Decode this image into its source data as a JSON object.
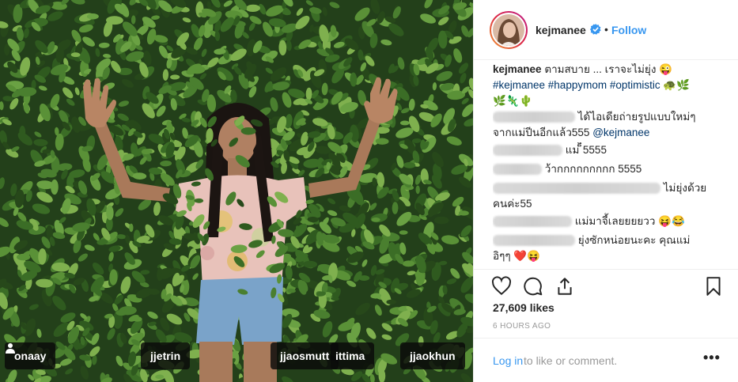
{
  "post": {
    "username": "kejmanee",
    "dot": "•",
    "follow_label": "Follow"
  },
  "photo_tags": [
    "onaay",
    "jjetrin",
    "jjaosmutt",
    "ittima",
    "jjaokhun"
  ],
  "caption": {
    "username": "kejmanee",
    "text": "ตามสบาย ... เราจะไม่ยุ่ง 😜",
    "hashtags": "#kejmanee #happymom #optimistic",
    "emoji_line1": "🐢🌿",
    "emoji_line2": "🌿🦎🌵"
  },
  "comments": [
    {
      "text": "ได้ไอเดียถ่ายรูปแบบใหม่ๆ",
      "text2": "จากแม่ปีนอีกแล้ว555",
      "mention": "@kejmanee"
    },
    {
      "text": "แม่ ็็็็็็็็็็็็็็็็็็็็็็็็็็็็็็็็็็็็็็็็็็็็็็็็็็็็็็็็็็็็็็็็็็็็็็็็็็็็็็็็็็็็็็็็็็็็็็็็็็็็็็็็็็็็็็็็็็็็็็็็็็็็็็็็็็็็็็็็็็็็็็็็็็็็็็็็็็็็็็็็็็็็็็็็็็็็็็็็็็็็็็็็็็็็็็็็็็็็็็็็็็็็็็็็็็็็็็็็็็็็็็็็็็็็็็็็็็็็็็็็็็็็็็็็็็็5555"
    },
    {
      "text": "ว้ากกกกกกกกก 5555"
    },
    {
      "text": "ไม่ยุ่งด้วย",
      "text2": "คนค่ะ55"
    },
    {
      "text": "แม่มาจี้เลยยยยวว 😝😂"
    },
    {
      "text": "ยุ่งซักหน่อยนะคะ คุณแม่",
      "text2": "อิๆๆ ❤️😝"
    }
  ],
  "stats": {
    "likes": "27,609 likes",
    "time": "6 HOURS AGO"
  },
  "footer": {
    "login_label": "Log in",
    "login_rest": "to like or comment.",
    "more_label": "•••"
  },
  "colors": {
    "link_blue": "#3897f0",
    "hashtag_navy": "#003569",
    "text_dark": "#262626",
    "muted_gray": "#999999",
    "divider": "#efefef"
  },
  "icons": [
    "verified-badge-icon",
    "heart-icon",
    "comment-icon",
    "share-icon",
    "bookmark-icon",
    "person-tag-icon"
  ]
}
